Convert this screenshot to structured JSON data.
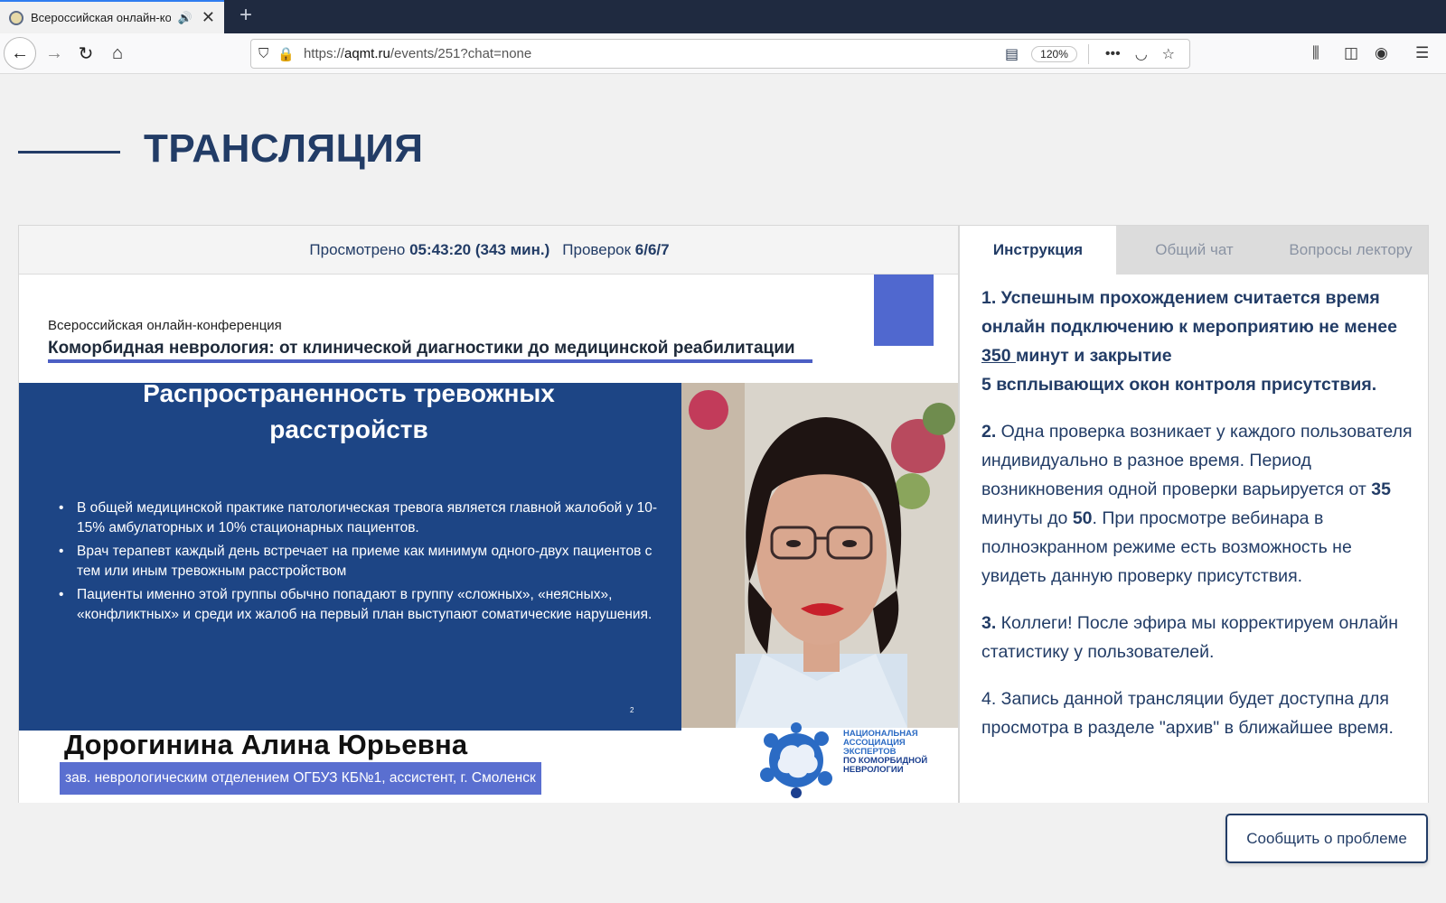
{
  "browser": {
    "tab_title": "Всероссийская онлайн-ко",
    "url_prefix": "https://",
    "url_domain": "aqmt.ru",
    "url_path": "/events/251?chat=none",
    "zoom": "120%"
  },
  "page": {
    "heading": "ТРАНСЛЯЦИЯ"
  },
  "stats": {
    "viewed_label": "Просмотрено",
    "viewed_value": "05:43:20 (343 мин.)",
    "checks_label": "Проверок",
    "checks_value": "6/6/7"
  },
  "video": {
    "conference_small": "Всероссийская онлайн-конференция",
    "conference_title": "Коморбидная неврология: от клинической диагностики до медицинской реабилитации",
    "slide_title_line1": "Распространенность тревожных",
    "slide_title_line2": "расстройств",
    "slide_bullets": [
      "В общей медицинской практике патологическая тревога является главной жалобой у 10-15% амбулаторных и 10% стационарных пациентов.",
      "Врач терапевт каждый день встречает на приеме как минимум одного-двух пациентов с тем или иным тревожным расстройством",
      "Пациенты именно этой группы обычно попадают в группу «сложных», «неясных», «конфликтных» и среди их жалоб на первый план  выступают соматические нарушения."
    ],
    "slide_number": "2",
    "speaker_name": "Дорогинина Алина Юрьевна",
    "speaker_position": "зав. неврологическим отделением ОГБУЗ КБ№1, ассистент, г. Смоленск",
    "logo_line1": "НАЦИОНАЛЬНАЯ",
    "logo_line2": "АССОЦИАЦИЯ",
    "logo_line3": "ЭКСПЕРТОВ",
    "logo_line4": "ПО КОМОРБИДНОЙ",
    "logo_line5": "НЕВРОЛОГИИ"
  },
  "sidebar": {
    "tabs": [
      "Инструкция",
      "Общий чат",
      "Вопросы лектору"
    ],
    "p1_a": "1. Успешным прохождением считается время онлайн подключению к мероприятию не менее ",
    "p1_num": "350 ",
    "p1_b": "минут и закрытие",
    "p1_c": "5 всплывающих окон контроля присутствия.",
    "p2_num": "2.",
    "p2_a": " Одна проверка возникает у каждого пользователя индивидуально в разное время. Период возникновения одной проверки варьируется от ",
    "p2_min": "35",
    "p2_b": " минуты до ",
    "p2_max": "50",
    "p2_c": ". При просмотре вебинара в полноэкранном режиме есть возможность не увидеть данную проверку присутствия.",
    "p3_num": "3.",
    "p3_text": " Коллеги! После эфира мы корректируем онлайн статистику у пользователей.",
    "p4_text": "4. Запись данной трансляции будет доступна для просмотра в разделе \"архив\" в ближайшее время."
  },
  "report_button": "Сообщить о проблеме"
}
